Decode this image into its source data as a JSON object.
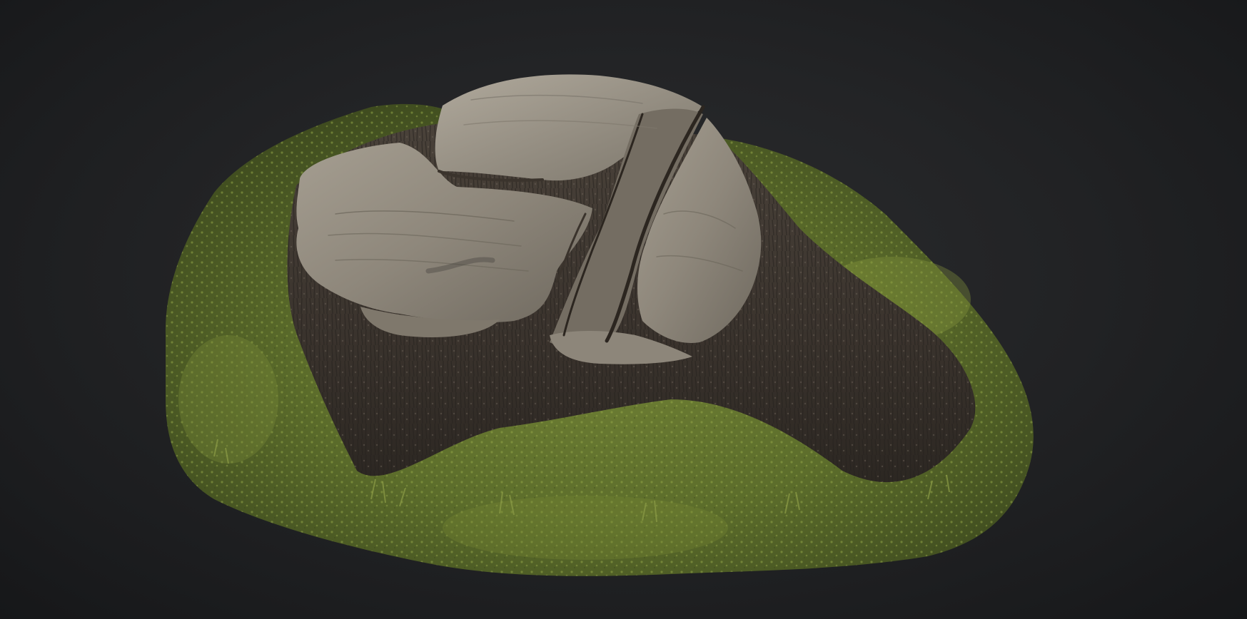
{
  "viewer": {
    "background_color": "#222325",
    "subject": "tree-stump-3d-scan"
  },
  "colors": {
    "moss_light": "#7d8f3a",
    "moss_dark": "#4a5a24",
    "bark_dark": "#3b352f",
    "bark_mid": "#5a5148",
    "wood_cut": "#9a9387",
    "wood_cut_light": "#b3ad9f"
  }
}
